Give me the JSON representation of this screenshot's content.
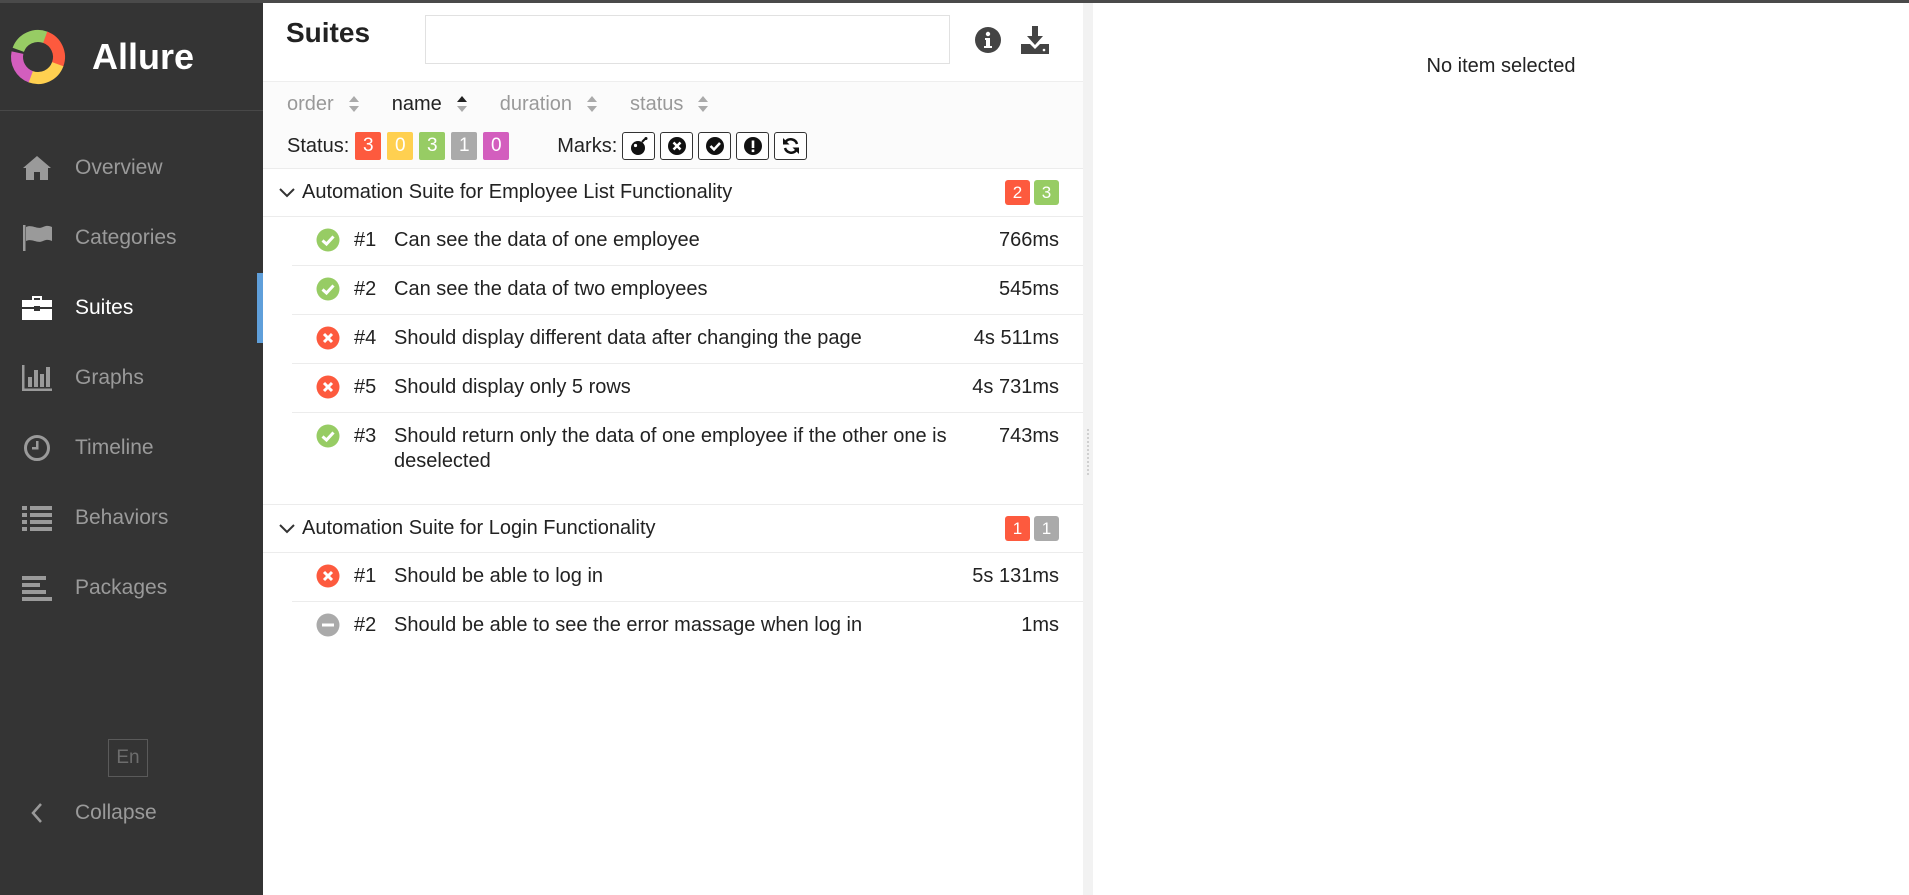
{
  "app": {
    "name": "Allure"
  },
  "sidebar": {
    "items": [
      {
        "label": "Overview",
        "icon": "home-icon",
        "active": false
      },
      {
        "label": "Categories",
        "icon": "flag-icon",
        "active": false
      },
      {
        "label": "Suites",
        "icon": "briefcase-icon",
        "active": true
      },
      {
        "label": "Graphs",
        "icon": "bar-chart-icon",
        "active": false
      },
      {
        "label": "Timeline",
        "icon": "clock-icon",
        "active": false
      },
      {
        "label": "Behaviors",
        "icon": "list-icon",
        "active": false
      },
      {
        "label": "Packages",
        "icon": "align-left-icon",
        "active": false
      }
    ],
    "language": "En",
    "collapse_label": "Collapse"
  },
  "main": {
    "title": "Suites",
    "search": {
      "value": "",
      "placeholder": ""
    },
    "sorter": {
      "order": "order",
      "name": "name",
      "duration": "duration",
      "status": "status"
    },
    "filters": {
      "status_label": "Status:",
      "status_counts": [
        {
          "value": "3",
          "color": "#fd5a3e"
        },
        {
          "value": "0",
          "color": "#ffd050"
        },
        {
          "value": "3",
          "color": "#97cc64"
        },
        {
          "value": "1",
          "color": "#aaaaaa"
        },
        {
          "value": "0",
          "color": "#d35ebe"
        }
      ],
      "marks_label": "Marks:",
      "marks": [
        "flaky-bomb-icon",
        "new-failed-icon",
        "new-passed-icon",
        "new-broken-icon",
        "retries-icon"
      ]
    },
    "groups": [
      {
        "name": "Automation Suite for Employee List Functionality",
        "counts": [
          {
            "value": "2",
            "color": "#fd5a3e"
          },
          {
            "value": "3",
            "color": "#97cc64"
          }
        ],
        "tests": [
          {
            "num": "#1",
            "name": "Can see the data of one employee",
            "duration": "766ms",
            "status": "passed"
          },
          {
            "num": "#2",
            "name": "Can see the data of two employees",
            "duration": "545ms",
            "status": "passed"
          },
          {
            "num": "#4",
            "name": "Should display different data after changing the page",
            "duration": "4s 511ms",
            "status": "failed"
          },
          {
            "num": "#5",
            "name": "Should display only 5 rows",
            "duration": "4s 731ms",
            "status": "failed"
          },
          {
            "num": "#3",
            "name": "Should return only the data of one employee if the other one is deselected",
            "duration": "743ms",
            "status": "passed"
          }
        ]
      },
      {
        "name": "Automation Suite for Login Functionality",
        "counts": [
          {
            "value": "1",
            "color": "#fd5a3e"
          },
          {
            "value": "1",
            "color": "#aaaaaa"
          }
        ],
        "tests": [
          {
            "num": "#1",
            "name": "Should be able to log in",
            "duration": "5s 131ms",
            "status": "failed"
          },
          {
            "num": "#2",
            "name": "Should be able to see the error massage when log in",
            "duration": "1ms",
            "status": "skipped"
          }
        ]
      }
    ]
  },
  "detail": {
    "empty_text": "No item selected"
  }
}
